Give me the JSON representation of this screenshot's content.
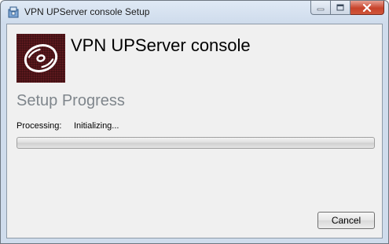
{
  "window": {
    "title": "VPN UPServer console Setup",
    "app_icon": "installer-package-icon",
    "caption_buttons": [
      "minimize-icon",
      "maximize-icon",
      "close-icon"
    ]
  },
  "header": {
    "logo_icon": "disc-icon",
    "product_name": "VPN UPServer console"
  },
  "progress_section": {
    "title": "Setup Progress",
    "status_label": "Processing:",
    "status_value": "Initializing...",
    "progress_fraction": 0
  },
  "footer": {
    "cancel_label": "Cancel"
  },
  "colors": {
    "logo_background": "#3a0f12",
    "section_title": "#7f868c",
    "close_button": "#c7432b"
  }
}
